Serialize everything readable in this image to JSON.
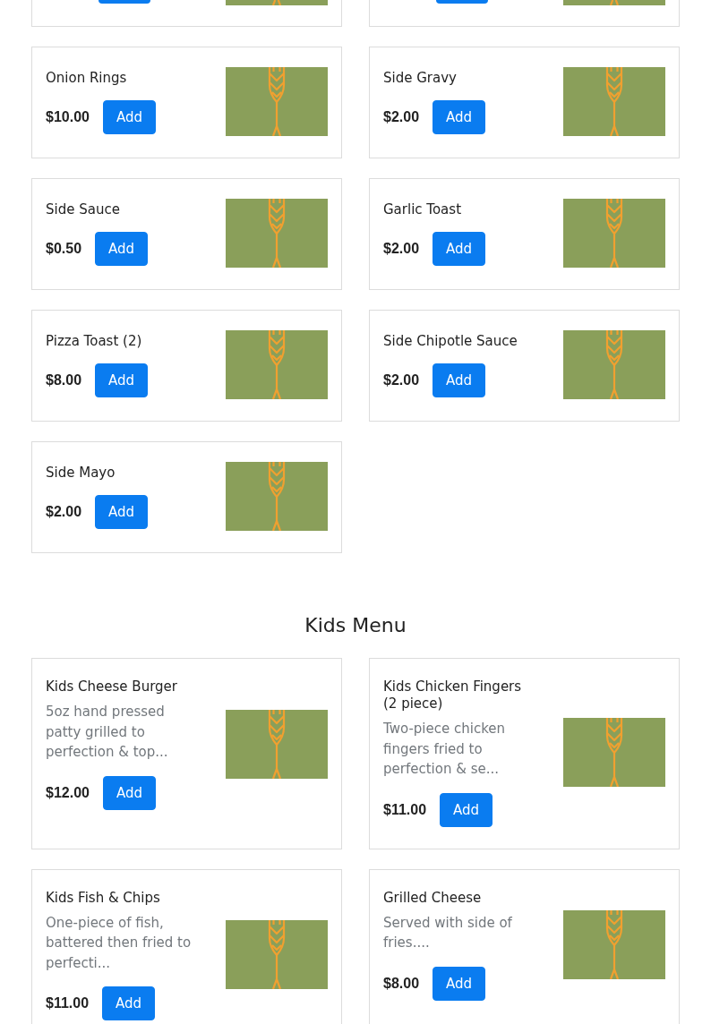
{
  "sections": [
    {
      "items": [
        {
          "kind": "cut_off"
        },
        {
          "kind": "cut_off"
        },
        {
          "kind": "item",
          "name": "Onion Rings",
          "price": "$10.00",
          "button": "Add"
        },
        {
          "kind": "item",
          "name": "Side Gravy",
          "price": "$2.00",
          "button": "Add"
        },
        {
          "kind": "item",
          "name": "Side Sauce",
          "price": "$0.50",
          "button": "Add"
        },
        {
          "kind": "item",
          "name": "Garlic Toast",
          "price": "$2.00",
          "button": "Add"
        },
        {
          "kind": "item",
          "name": "Pizza Toast (2)",
          "price": "$8.00",
          "button": "Add"
        },
        {
          "kind": "item",
          "name": "Side Chipotle Sauce",
          "price": "$2.00",
          "button": "Add"
        },
        {
          "kind": "item",
          "name": "Side Mayo",
          "price": "$2.00",
          "button": "Add"
        }
      ]
    },
    {
      "title": "Kids Menu",
      "items": [
        {
          "kind": "item",
          "name": "Kids Cheese Burger",
          "description": "5oz hand pressed patty grilled to perfection & top...",
          "price": "$12.00",
          "button": "Add"
        },
        {
          "kind": "item",
          "name": "Kids Chicken Fingers (2 piece)",
          "description": "Two-piece chicken fingers fried to perfection & se...",
          "price": "$11.00",
          "button": "Add"
        },
        {
          "kind": "item",
          "name": "Kids Fish & Chips",
          "description": "One-piece of fish, battered then fried to perfecti...",
          "price": "$11.00",
          "button": "Add"
        },
        {
          "kind": "item",
          "name": "Grilled Cheese",
          "description": "Served with side of fries....",
          "price": "$8.00",
          "button": "Add"
        }
      ]
    }
  ]
}
